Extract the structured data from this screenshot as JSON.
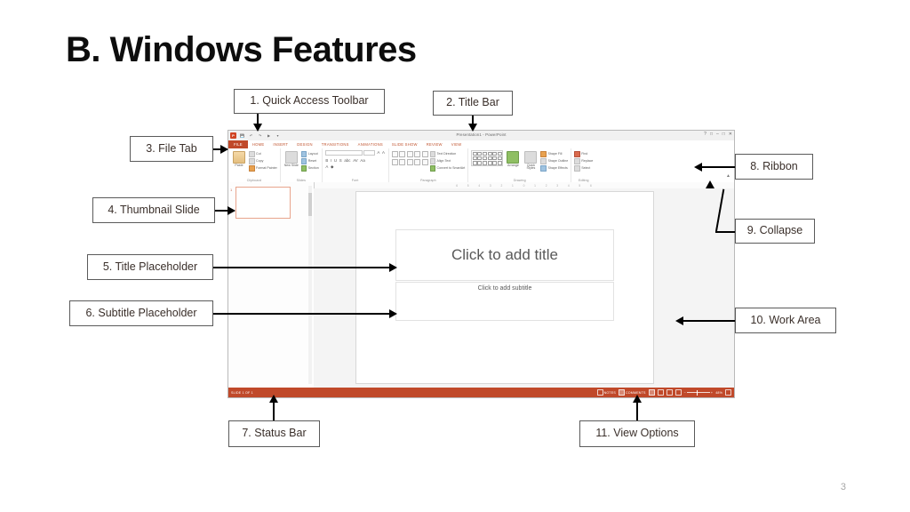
{
  "slide": {
    "title": "B. Windows Features",
    "page_number": "3"
  },
  "callouts": [
    {
      "id": "quick-access-toolbar",
      "label": "1. Quick Access Toolbar"
    },
    {
      "id": "title-bar",
      "label": "2. Title Bar"
    },
    {
      "id": "file-tab",
      "label": "3. File Tab"
    },
    {
      "id": "thumbnail-slide",
      "label": "4. Thumbnail Slide"
    },
    {
      "id": "title-placeholder",
      "label": "5. Title Placeholder"
    },
    {
      "id": "subtitle-placeholder",
      "label": "6. Subtitle Placeholder"
    },
    {
      "id": "status-bar",
      "label": "7. Status Bar"
    },
    {
      "id": "ribbon",
      "label": "8. Ribbon"
    },
    {
      "id": "collapse",
      "label": "9. Collapse"
    },
    {
      "id": "work-area",
      "label": "10. Work Area"
    },
    {
      "id": "view-options",
      "label": "11. View Options"
    }
  ],
  "powerpoint": {
    "titlebar": {
      "document_title": "Presentation1  -  PowerPoint",
      "quick_access": [
        "powerpoint-icon",
        "save-icon",
        "undo-icon",
        "redo-icon",
        "start-from-beginning-icon",
        "customize-qat-icon"
      ],
      "window_controls": [
        "help-icon",
        "ribbon-display-options-icon",
        "minimize-icon",
        "restore-icon",
        "close-icon"
      ]
    },
    "tabs": [
      "FILE",
      "HOME",
      "INSERT",
      "DESIGN",
      "TRANSITIONS",
      "ANIMATIONS",
      "SLIDE SHOW",
      "REVIEW",
      "VIEW"
    ],
    "active_tab": "HOME",
    "ribbon_groups": [
      {
        "name": "Clipboard",
        "big_button": "Paste",
        "small_buttons": [
          "Cut",
          "Copy",
          "Format Painter"
        ]
      },
      {
        "name": "Slides",
        "big_button": "New Slide",
        "small_buttons": [
          "Layout",
          "Reset",
          "Section"
        ]
      },
      {
        "name": "Font",
        "font_name": "",
        "font_size": "",
        "tools": [
          "B",
          "I",
          "U",
          "S",
          "abc",
          "AV",
          "Aa"
        ]
      },
      {
        "name": "Paragraph",
        "small_buttons": [
          "Text Direction",
          "Align Text",
          "Convert to SmartArt"
        ]
      },
      {
        "name": "Drawing",
        "big_buttons": [
          "Arrange",
          "Quick Styles"
        ],
        "small_buttons": [
          "Shape Fill",
          "Shape Outline",
          "Shape Effects"
        ]
      },
      {
        "name": "Editing",
        "small_buttons": [
          "Find",
          "Replace",
          "Select"
        ]
      }
    ],
    "ruler_ticks": [
      "6",
      "5",
      "4",
      "3",
      "2",
      "1",
      "0",
      "1",
      "2",
      "3",
      "4",
      "5",
      "6"
    ],
    "thumbnail": {
      "number": "1"
    },
    "canvas": {
      "title_placeholder": "Click to add title",
      "subtitle_placeholder": "Click to add subtitle"
    },
    "statusbar": {
      "slide_info": "SLIDE 1 OF 1",
      "notes_label": "NOTES",
      "comments_label": "COMMENTS",
      "view_buttons": [
        "normal-view-icon",
        "slide-sorter-icon",
        "reading-view-icon",
        "slide-show-icon"
      ],
      "zoom_out": "−",
      "zoom_in": "+",
      "zoom_level": "48%",
      "fit_to_window": "fit-to-window-icon"
    },
    "collapse_caret": "▲"
  },
  "colors": {
    "accent": "#c0492a",
    "callout_border": "#5a5a5a",
    "callout_text": "#3a2f2a",
    "thumbnail_selected": "#e8a48c"
  }
}
